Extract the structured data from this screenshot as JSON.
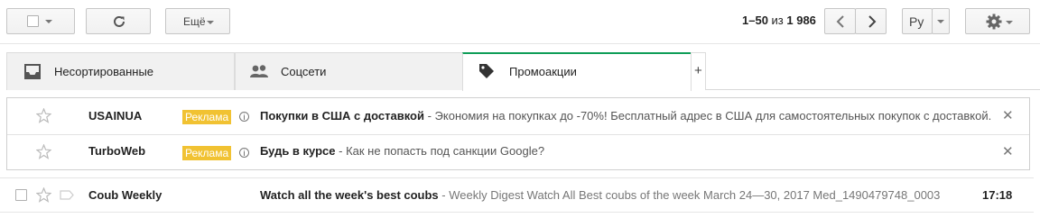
{
  "toolbar": {
    "more_label": "Ещё",
    "pager_range": "1–50",
    "pager_of": " из ",
    "pager_total": "1 986",
    "lang_label": "Ру"
  },
  "tabs": [
    {
      "label": "Несортированные",
      "icon": "inbox-icon",
      "active": false
    },
    {
      "label": "Соцсети",
      "icon": "people-icon",
      "active": false
    },
    {
      "label": "Промоакции",
      "icon": "tag-icon",
      "active": true
    }
  ],
  "add_tab_label": "+",
  "ads": [
    {
      "sender": "USAINUA",
      "badge": "Реклама",
      "subject": "Покупки в США с доставкой",
      "snippet": " - Экономия на покупках до -70%! Бесплатный адрес в США для самостоятельных покупок с доставкой."
    },
    {
      "sender": "TurboWeb",
      "badge": "Реклама",
      "subject": "Будь в курсе",
      "snippet": " - Как не попасть под санкции Google?"
    }
  ],
  "emails": [
    {
      "sender": "Coub Weekly",
      "subject": "Watch all the week's best coubs",
      "snippet": " - Weekly Digest Watch All Best coubs of the week March 24—30, 2017 Med_1490479748_0003",
      "time": "17:18"
    }
  ],
  "colors": {
    "accent_green": "#0f9d58",
    "ad_badge": "#f1c232"
  }
}
